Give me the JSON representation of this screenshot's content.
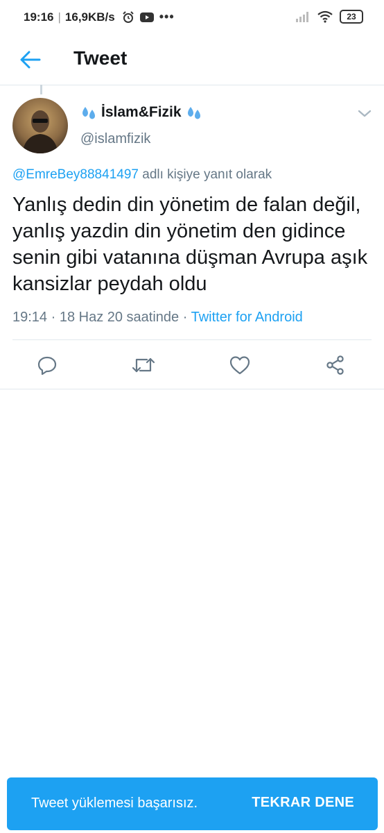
{
  "status_bar": {
    "time": "19:16",
    "speed": "16,9KB/s",
    "battery": "23"
  },
  "app_bar": {
    "title": "Tweet"
  },
  "tweet": {
    "author_name": "İslam&Fizik",
    "author_handle": "@islamfizik",
    "reply_to_handle": "@EmreBey88841497",
    "reply_suffix": "adlı kişiye yanıt olarak",
    "text": "Yanlış dedin din yönetim de falan değil, yanlış yazdin din yönetim den gidince senin gibi vatanına düşman Avrupa aşık kansizlar peydah oldu",
    "timestamp": "19:14 · 18 Haz 20 saatinde ·",
    "source": "Twitter for Android"
  },
  "actions": {
    "reply_icon": "reply-icon",
    "retweet_icon": "retweet-icon",
    "like_icon": "heart-icon",
    "share_icon": "share-icon"
  },
  "snackbar": {
    "message": "Tweet yüklemesi başarısız.",
    "action_label": "TEKRAR DENE"
  },
  "colors": {
    "accent": "#1da1f2",
    "text_primary": "#14171a",
    "text_secondary": "#657786",
    "divider": "#e1e8ed"
  }
}
